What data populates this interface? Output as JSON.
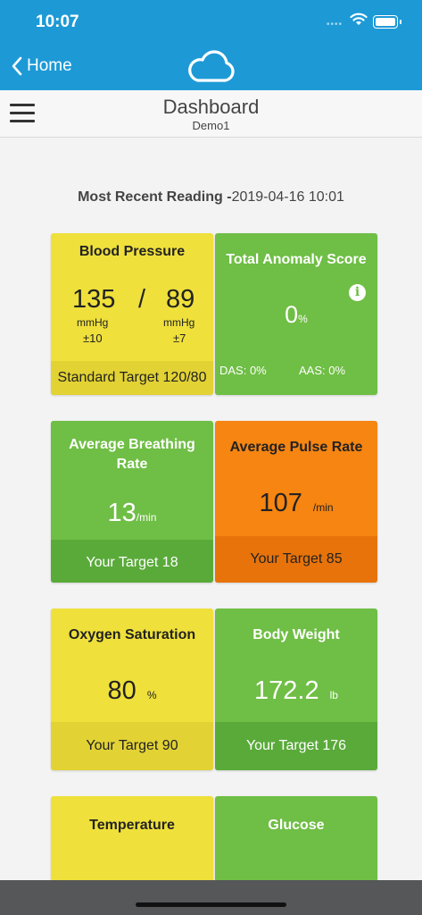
{
  "status_bar": {
    "time": "10:07"
  },
  "nav": {
    "back_label": "Home"
  },
  "header": {
    "title": "Dashboard",
    "subtitle": "Demo1"
  },
  "recent": {
    "label": "Most Recent Reading -",
    "datetime": "2019-04-16 10:01"
  },
  "tiles": {
    "blood_pressure": {
      "title": "Blood Pressure",
      "systolic": "135",
      "diastolic": "89",
      "separator": "/",
      "systolic_unit": "mmHg",
      "diastolic_unit": "mmHg",
      "systolic_tol": "±10",
      "diastolic_tol": "±7",
      "footer": "Standard Target 120/80",
      "color": "#efe03b"
    },
    "anomaly": {
      "title": "Total Anomaly Score",
      "value": "0",
      "unit": "%",
      "das": "DAS: 0%",
      "aas": "AAS: 0%",
      "info_icon": "i",
      "color": "#6fbe45"
    },
    "breathing": {
      "title": "Average Breathing Rate",
      "value": "13",
      "unit": "/min",
      "footer": "Your Target 18",
      "color": "#6fbe45"
    },
    "pulse": {
      "title": "Average Pulse Rate",
      "value": "107",
      "unit": "/min",
      "footer": "Your Target 85",
      "color": "#f68512"
    },
    "oxygen": {
      "title": "Oxygen Saturation",
      "value": "80",
      "unit": "%",
      "footer": "Your Target 90",
      "color": "#efe03b"
    },
    "weight": {
      "title": "Body Weight",
      "value": "172.2",
      "unit": "lb",
      "footer": "Your Target 176",
      "color": "#6fbe45"
    },
    "temperature": {
      "title": "Temperature",
      "color": "#efe03b"
    },
    "glucose": {
      "title": "Glucose",
      "color": "#6fbe45"
    }
  }
}
